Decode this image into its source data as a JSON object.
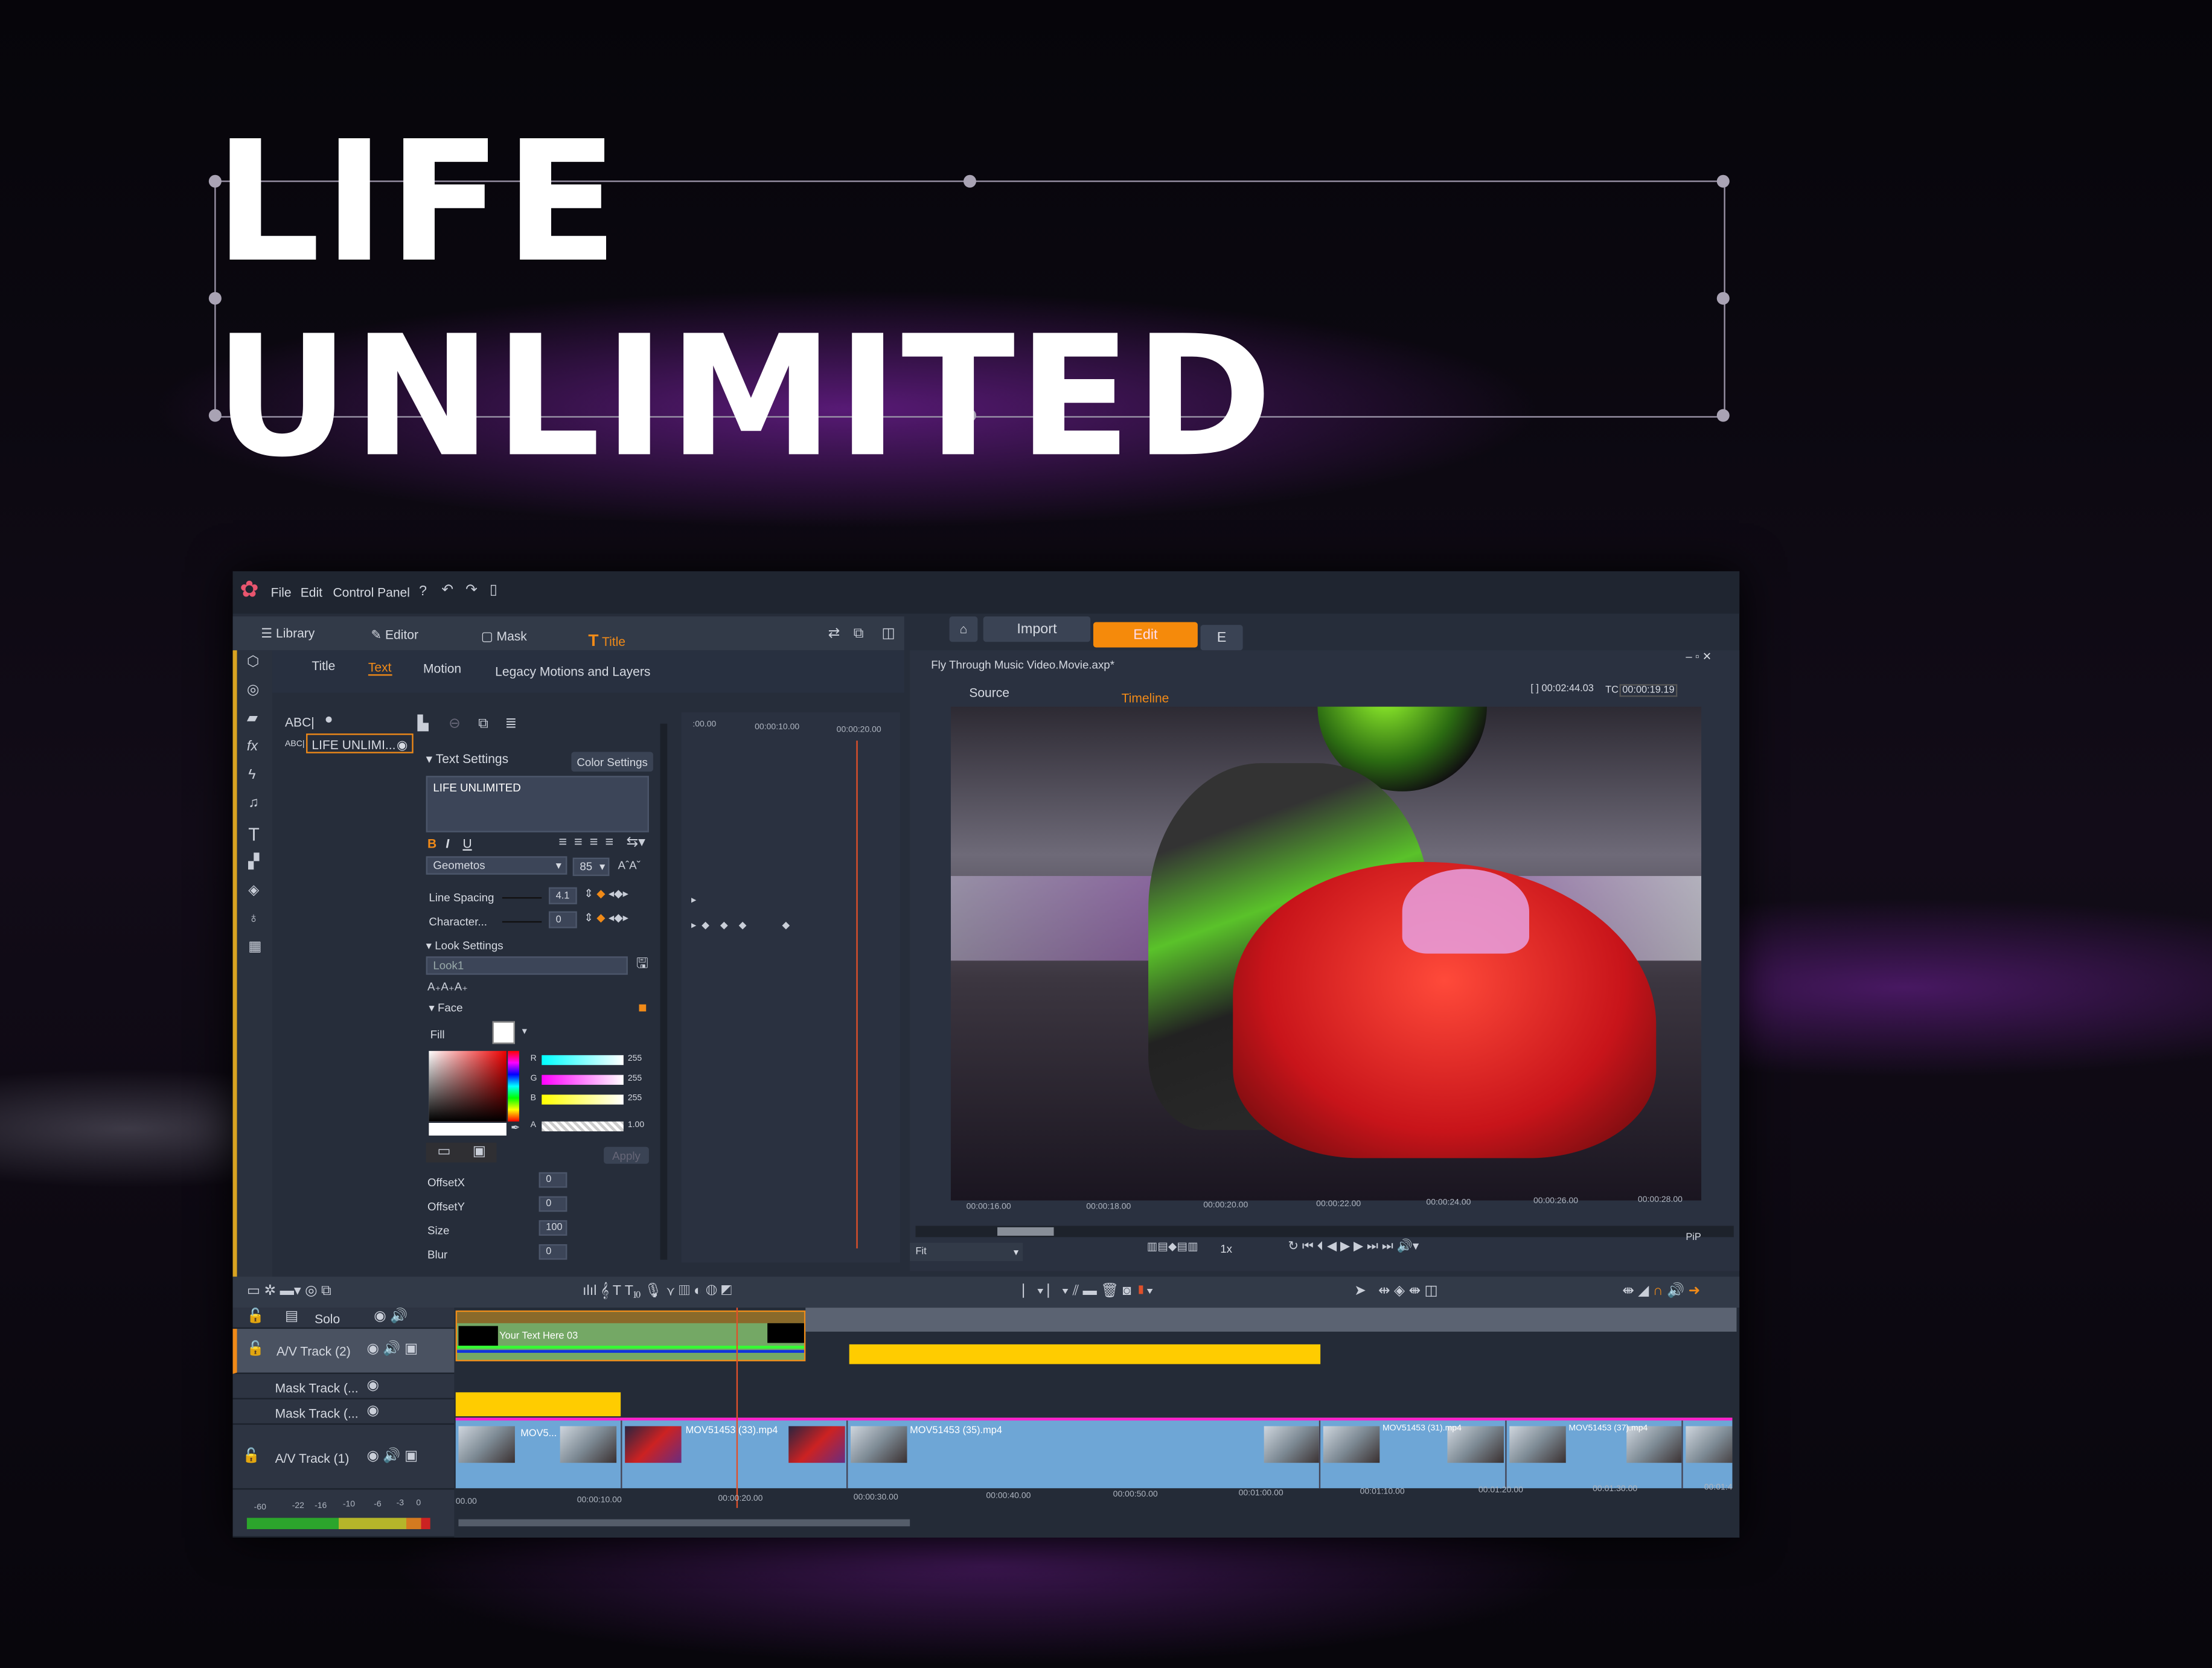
{
  "headline": "LIFE UNLIMITED",
  "menu": {
    "items": [
      "File",
      "Edit",
      "Control Panel"
    ]
  },
  "nav": {
    "import": "Import",
    "edit": "Edit",
    "export": "E"
  },
  "editor_tabs": [
    {
      "label": "Library"
    },
    {
      "label": "Editor"
    },
    {
      "label": "Mask"
    },
    {
      "label": "Title",
      "active": true
    }
  ],
  "sub_tabs": [
    {
      "label": "Title"
    },
    {
      "label": "Text",
      "active": true
    },
    {
      "label": "Motion"
    },
    {
      "label": "Legacy Motions and Layers"
    }
  ],
  "layers": {
    "header": "ABC|",
    "item": "LIFE UNLIMI...",
    "item_prefix": "ABC|"
  },
  "text_settings": {
    "section": "Text Settings",
    "color_settings": "Color Settings",
    "text": "LIFE UNLIMITED",
    "bold": "B",
    "italic": "I",
    "underline": "U",
    "font": "Geometos",
    "size": "85",
    "line_spacing_label": "Line Spacing",
    "line_spacing": "4.1",
    "character_label": "Character...",
    "character": "0"
  },
  "look_settings": {
    "section": "Look Settings",
    "look": "Look1",
    "face": "Face",
    "fill": "Fill",
    "r_label": "R",
    "g_label": "G",
    "b_label": "B",
    "a_label": "A",
    "r": "255",
    "g": "255",
    "b": "255",
    "a": "1.00",
    "apply": "Apply",
    "offsetx_label": "OffsetX",
    "offsetx": "0",
    "offsety_label": "OffsetY",
    "offsety": "0",
    "size_label": "Size",
    "size": "100",
    "blur_label": "Blur",
    "blur": "0"
  },
  "keyframe_ruler": [
    ":00.00",
    "00:00:10.00",
    "00:00:20.00"
  ],
  "player": {
    "project": "Fly Through Music Video.Movie.axp*",
    "source_tab": "Source",
    "timeline_tab": "Timeline",
    "duration": "[ ] 00:02:44.03",
    "tc_label": "TC",
    "timecode": "00:00:19.19",
    "ruler": [
      "00:00:16.00",
      "00:00:18.00",
      "00:00:20.00",
      "00:00:22.00",
      "00:00:24.00",
      "00:00:26.00",
      "00:00:28.00"
    ],
    "zoom": "Fit",
    "speed": "1x",
    "pip": "PiP"
  },
  "timeline": {
    "solo": "Solo",
    "tracks": [
      {
        "name": "A/V Track (2)"
      },
      {
        "name": "Mask Track (..."
      },
      {
        "name": "Mask Track (..."
      },
      {
        "name": "A/V Track (1)"
      }
    ],
    "title_clip": "Your Text Here 03",
    "clips": [
      "MOV5...",
      "MOV51453 (33).mp4",
      "MOV51453 (35).mp4",
      "MOV51453 (31).mp4",
      "MOV51453 (37).mp4"
    ],
    "ruler": [
      "00.00",
      "00:00:10.00",
      "00:00:20.00",
      "00:00:30.00",
      "00:00:40.00",
      "00:00:50.00",
      "00:01:00.00",
      "00:01:10.00",
      "00:01:20.00",
      "00:01:30.00",
      "00:01:4"
    ],
    "meter": [
      "-60",
      "-22",
      "-16",
      "-10",
      "-6",
      "-3",
      "0"
    ]
  },
  "colors": {
    "accent": "#f08a18",
    "title_clip": "#74a865",
    "video_clip": "#6ea6d6",
    "mask_clip": "#ffcc00",
    "playhead": "#e0502a"
  }
}
